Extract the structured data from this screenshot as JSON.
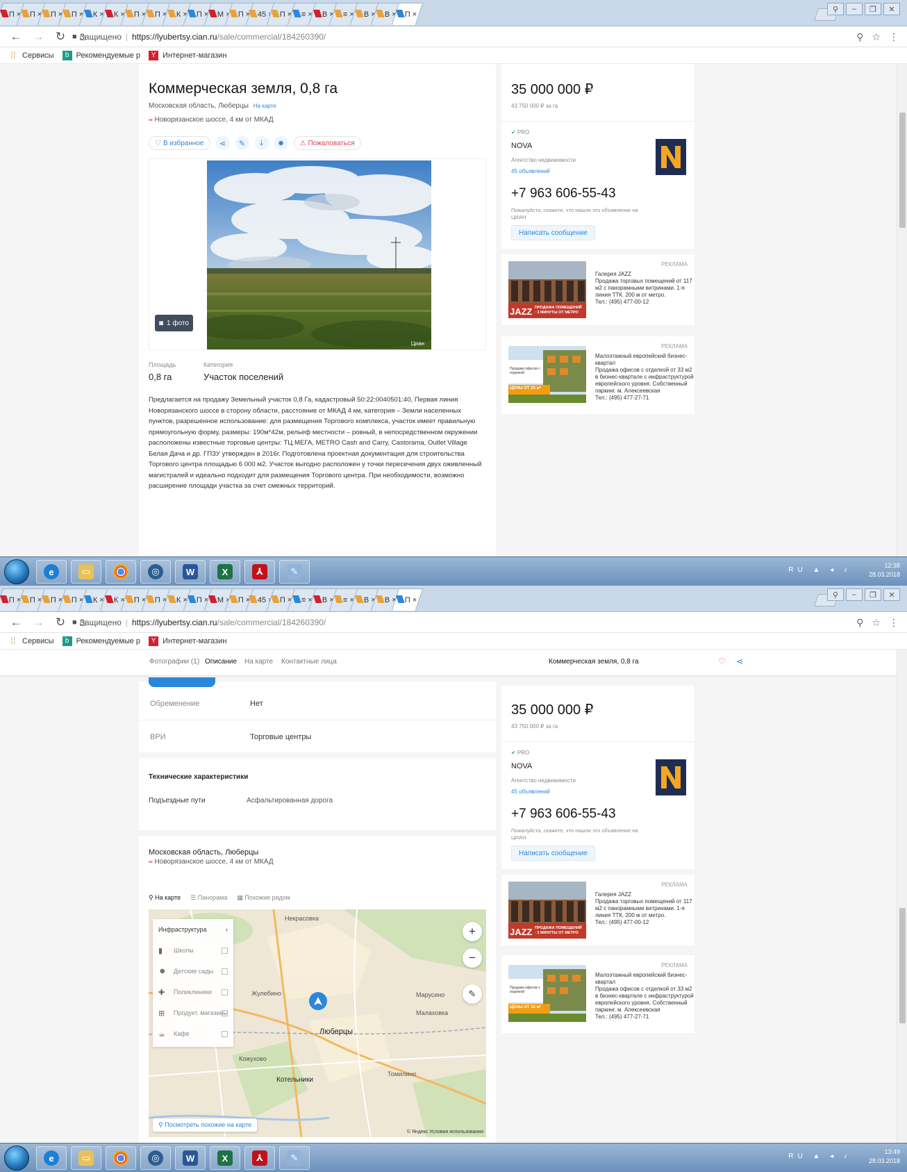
{
  "tab_titles": [
    "П",
    "П",
    "П",
    "П",
    "К",
    "К",
    "П",
    "П",
    "К",
    "П",
    "М",
    "П",
    "45",
    "П",
    "≡",
    "В",
    "≡",
    "В",
    "В",
    "П"
  ],
  "browser": {
    "secure_label": "Защищено",
    "url_host": "https://lyubertsy.cian.ru",
    "url_path": "/sale/commercial/184260390/",
    "bookmarks": [
      "Сервисы",
      "Рекомендуемые р",
      "Интернет-магазин"
    ]
  },
  "listing": {
    "title": "Коммерческая земля, 0,8 га",
    "region": "Московская область, Люберцы",
    "on_map_link": "На карте",
    "highway": "Новорязанское шоссе, 4 км от МКАД",
    "favorite_btn": "В избранное",
    "complain_btn": "Пожаловаться",
    "photo_count": "1 фото",
    "photo_watermark": "Циан",
    "area_label": "Площадь",
    "area_value": "0,8 га",
    "category_label": "Категория",
    "category_value": "Участок поселений",
    "description": "Предлагается на продажу Земельный участок 0,8 Га, кадастровый 50:22:0040501:40, Первая линия Новорязанского шоссе в сторону области, расстояние от МКАД 4 км, категория – Земли населенных пунктов, разрешенное использование: для размещения Торгового комплекса, участок имеет правильную прямоугольную форму, размеры: 190м*42м, рельеф местности – ровный, в непосредственном окружении расположены известные торговые центры: ТЦ МЕГА, METRO Cash and Carry, Castorama, Outlet Village Белая Дача и др. ГПЗУ утвержден в 2016г. Подготовлена проектная документация для строительства Торгового центра площадью 6 000 м2. Участок выгодно расположен у точки пересечения двух оживленный магистралей и идеально подходит для размещения Торгового центра. При необходимости, возможно расширение площади участка за счет смежных территорий."
  },
  "sidebar": {
    "price": "35 000 000 ₽",
    "price_per": "43 750 000 ₽ за га",
    "pro_badge": "PRO",
    "agency_name": "NOVA",
    "agency_type": "Агентство недвижимости",
    "agency_ads": "45 объявлений",
    "phone": "+7 963 606-55-43",
    "phone_note": "Пожалуйста, скажите, что нашли это объявление на ЦИАН",
    "message_btn": "Написать сообщение"
  },
  "ads": [
    {
      "label": "РЕКЛАМА",
      "title": "Галерея JAZZ",
      "text": "Продажа торговых помещений от 117 м2 с панорамными витринами. 1-я линия ТТК. 200 м от метро.",
      "phone": "Тел.: (495) 477-00-12",
      "img_caption": "JAZZ",
      "img_banner": "ПРОДАЖА ПОМЕЩЕНИЙ · 3 МИНУТЫ ОТ МЕТРО"
    },
    {
      "label": "РЕКЛАМА",
      "title": "Малоэтажный европейский бизнес-квартал",
      "text": "Продажа офисов с отделкой от 33 м2 в бизнес-квартале с инфраструктурой европейского уровня. Собственный паркинг. м. Алексеевская",
      "phone": "Тел.: (495) 477-27-71",
      "img_caption": "ЦЕНЫ ОТ 33 м²",
      "img_banner": "Продажа офисов с отделкой"
    }
  ],
  "taskbar": {
    "lang": "RU",
    "time1": "12:38",
    "date1": "28.03.2018",
    "time2": "13:49",
    "date2": "28.03.2018"
  },
  "sticky": {
    "tabs": [
      "Фотографии (1)",
      "Описание",
      "На карте",
      "Контактные лица"
    ],
    "title": "Коммерческая земля, 0,8 га"
  },
  "details": {
    "rows": [
      {
        "key": "Обременение",
        "value": "Нет"
      },
      {
        "key": "ВРИ",
        "value": "Торговые центры"
      }
    ],
    "tech_header": "Технические характеристики",
    "tech_rows": [
      {
        "key": "Подъездные пути",
        "value": "Асфальтированная дорога"
      }
    ]
  },
  "map": {
    "region": "Московская область, Люберцы",
    "highway": "Новорязанское шоссе, 4 км от МКАД",
    "tabs": [
      "На карте",
      "Панорама",
      "Похожие рядом"
    ],
    "infra_title": "Инфраструктура",
    "infra_items": [
      "Школы",
      "Детские сады",
      "Поликлиники",
      "Продукт. магазины",
      "Кафе"
    ],
    "places": [
      "Люберцы",
      "Котельники",
      "Марусино",
      "Томилино",
      "Жулебино",
      "Некрасовка",
      "Малаховка",
      "Кожухово"
    ],
    "similar_btn": "Посмотреть похожие на карте",
    "attribution": "© Яндекс Условия использования"
  }
}
